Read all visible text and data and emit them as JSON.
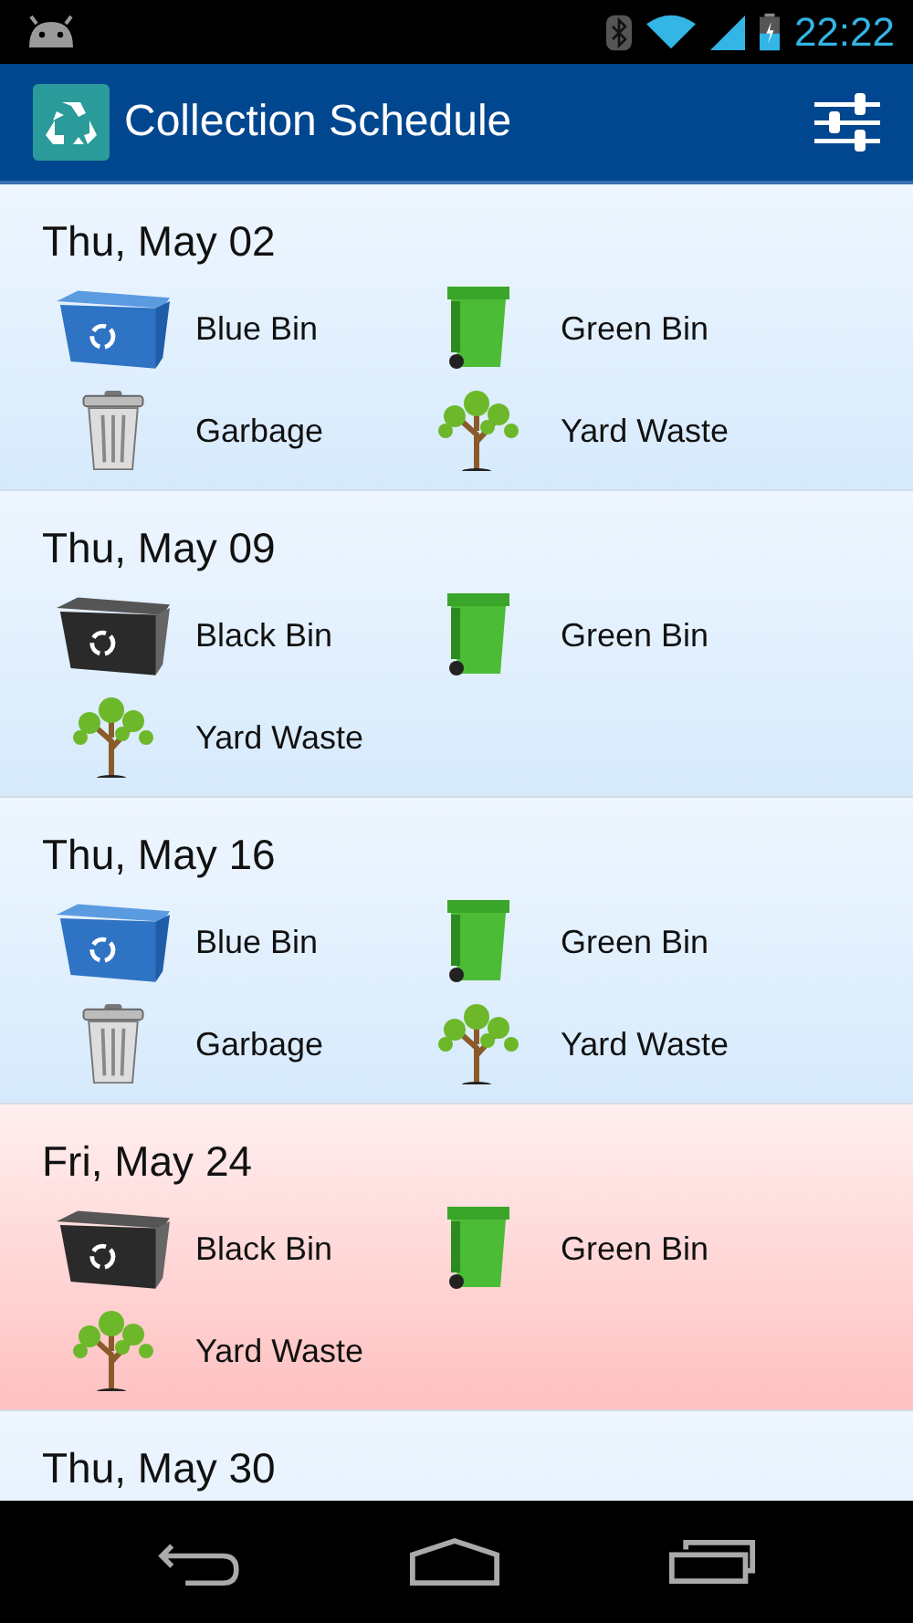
{
  "status_bar": {
    "time": "22:22"
  },
  "app_bar": {
    "title": "Collection Schedule"
  },
  "days": [
    {
      "date": "Thu, May 02",
      "highlighted": false,
      "items": [
        {
          "kind": "blue-bin",
          "label": "Blue Bin"
        },
        {
          "kind": "green-bin",
          "label": "Green Bin"
        },
        {
          "kind": "garbage",
          "label": "Garbage"
        },
        {
          "kind": "yard-waste",
          "label": "Yard Waste"
        }
      ]
    },
    {
      "date": "Thu, May 09",
      "highlighted": false,
      "items": [
        {
          "kind": "black-bin",
          "label": "Black Bin"
        },
        {
          "kind": "green-bin",
          "label": "Green Bin"
        },
        {
          "kind": "yard-waste",
          "label": "Yard Waste"
        }
      ]
    },
    {
      "date": "Thu, May 16",
      "highlighted": false,
      "items": [
        {
          "kind": "blue-bin",
          "label": "Blue Bin"
        },
        {
          "kind": "green-bin",
          "label": "Green Bin"
        },
        {
          "kind": "garbage",
          "label": "Garbage"
        },
        {
          "kind": "yard-waste",
          "label": "Yard Waste"
        }
      ]
    },
    {
      "date": "Fri, May 24",
      "highlighted": true,
      "items": [
        {
          "kind": "black-bin",
          "label": "Black Bin"
        },
        {
          "kind": "green-bin",
          "label": "Green Bin"
        },
        {
          "kind": "yard-waste",
          "label": "Yard Waste"
        }
      ]
    },
    {
      "date": "Thu, May 30",
      "highlighted": false
    }
  ]
}
